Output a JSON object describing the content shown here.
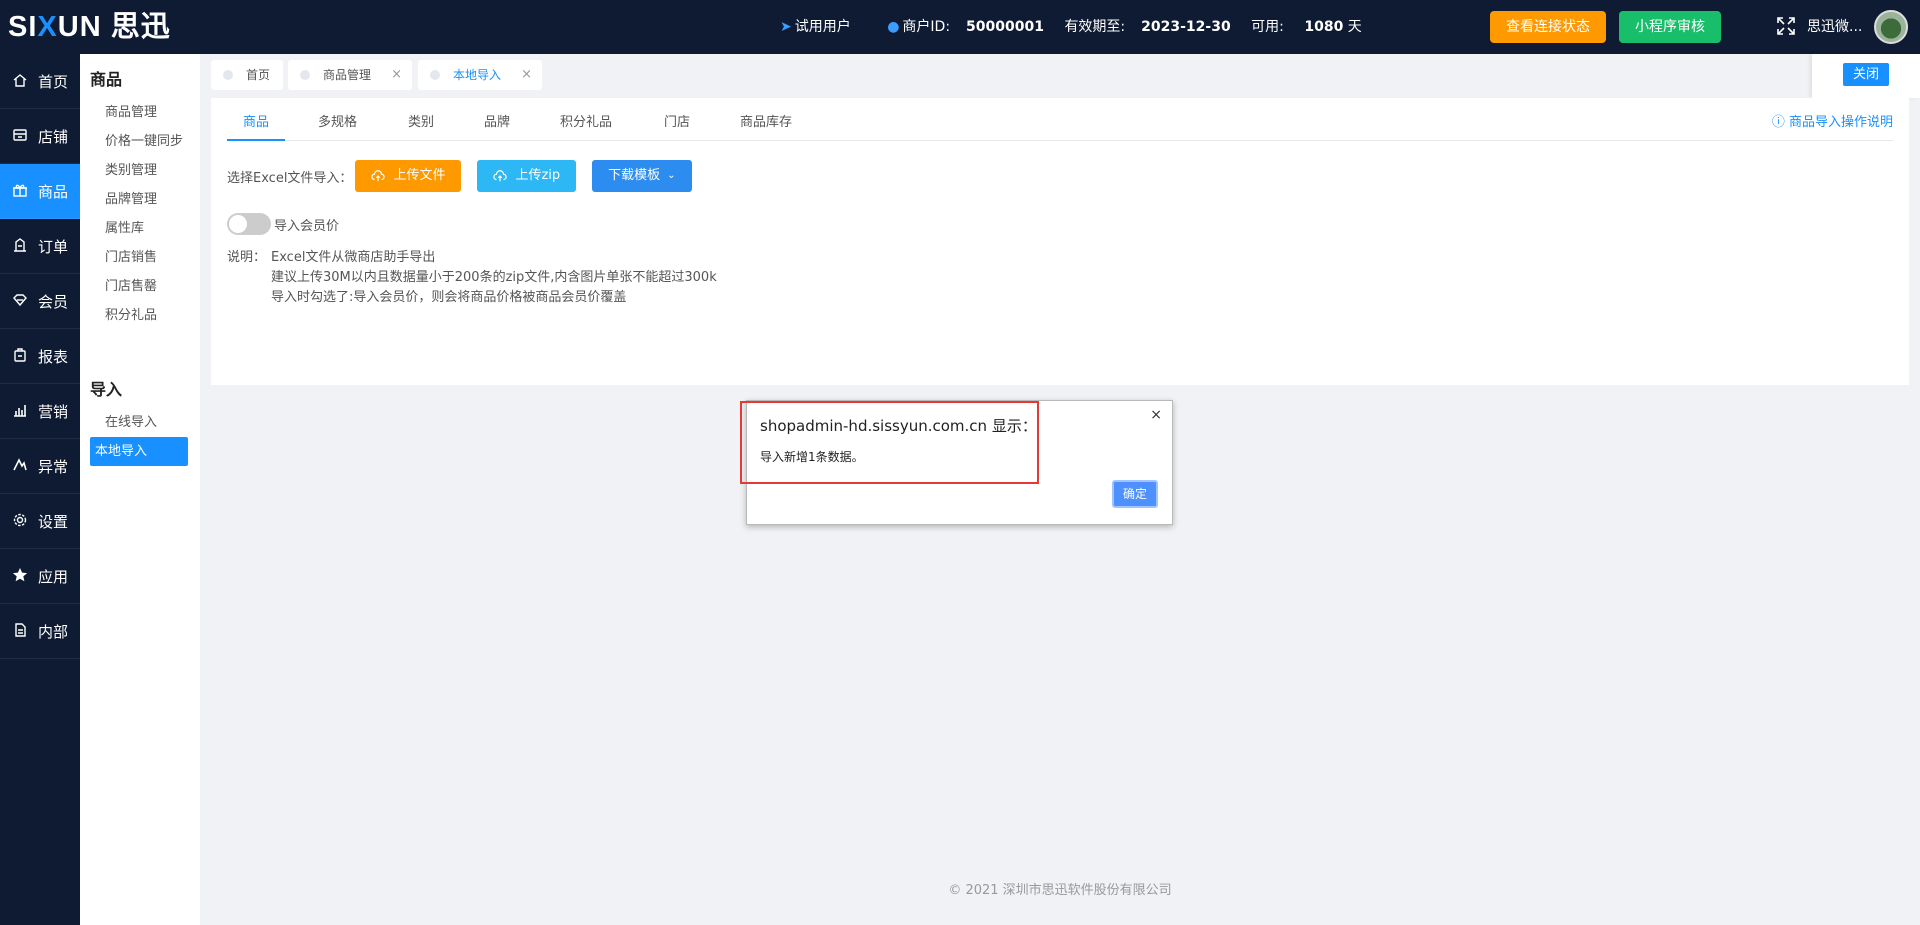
{
  "header": {
    "logo_text_a": "SI",
    "logo_text_x": "X",
    "logo_text_b": "UN 思迅",
    "trial_user": "试用用户",
    "merchant_label": "商户ID:",
    "merchant_id": "50000001",
    "valid_label": "有效期至:",
    "valid_date": "2023-12-30",
    "avail_label": "可用: ",
    "avail_days": "1080",
    "avail_unit": " 天",
    "btn_status": "查看连接状态",
    "btn_review": "小程序审核",
    "user_name": "思迅微..."
  },
  "mainnav": [
    {
      "label": "首页",
      "icon": "home-icon"
    },
    {
      "label": "店铺",
      "icon": "store-icon"
    },
    {
      "label": "商品",
      "icon": "gift-icon",
      "active": true
    },
    {
      "label": "订单",
      "icon": "order-icon"
    },
    {
      "label": "会员",
      "icon": "diamond-icon"
    },
    {
      "label": "报表",
      "icon": "report-icon"
    },
    {
      "label": "营销",
      "icon": "chart-icon"
    },
    {
      "label": "异常",
      "icon": "warning-icon"
    },
    {
      "label": "设置",
      "icon": "gear-icon"
    },
    {
      "label": "应用",
      "icon": "star-icon"
    },
    {
      "label": "内部",
      "icon": "document-icon"
    }
  ],
  "subnav": {
    "group1_title": "商品",
    "group1": [
      "商品管理",
      "价格一键同步",
      "类别管理",
      "品牌管理",
      "属性库",
      "门店销售",
      "门店售罄",
      "积分礼品"
    ],
    "group2_title": "导入",
    "group2": [
      "在线导入",
      "本地导入"
    ]
  },
  "pagetabs": [
    {
      "label": "首页"
    },
    {
      "label": "商品管理",
      "close": "×"
    },
    {
      "label": "本地导入",
      "close": "×"
    }
  ],
  "close_label": "关闭",
  "content": {
    "tabs": [
      "商品",
      "多规格",
      "类别",
      "品牌",
      "积分礼品",
      "门店",
      "商品库存"
    ],
    "help": "商品导入操作说明",
    "select_label": "选择Excel文件导入：",
    "btn_upload_file": "上传文件",
    "btn_upload_zip": "上传zip",
    "btn_download_tpl": "下载模板",
    "import_member_price": "导入会员价",
    "note_key": "说明：",
    "note_lines": [
      "Excel文件从微商店助手导出",
      "建议上传30M以内且数据量小于200条的zip文件,内含图片单张不能超过300k",
      "导入时勾选了:导入会员价，则会将商品价格被商品会员价覆盖"
    ]
  },
  "footer": "© 2021 深圳市思迅软件股份有限公司",
  "dialog": {
    "origin": "shopadmin-hd.sissyun.com.cn 显示：",
    "message": "导入新增1条数据。",
    "close": "×",
    "ok": "确定"
  },
  "colors": {
    "nav_bg": "#0e1b33",
    "accent": "#1890ff",
    "orange": "#ff9900",
    "green": "#19be6b",
    "cyan": "#2db7f5",
    "highlight": "#e53935"
  }
}
